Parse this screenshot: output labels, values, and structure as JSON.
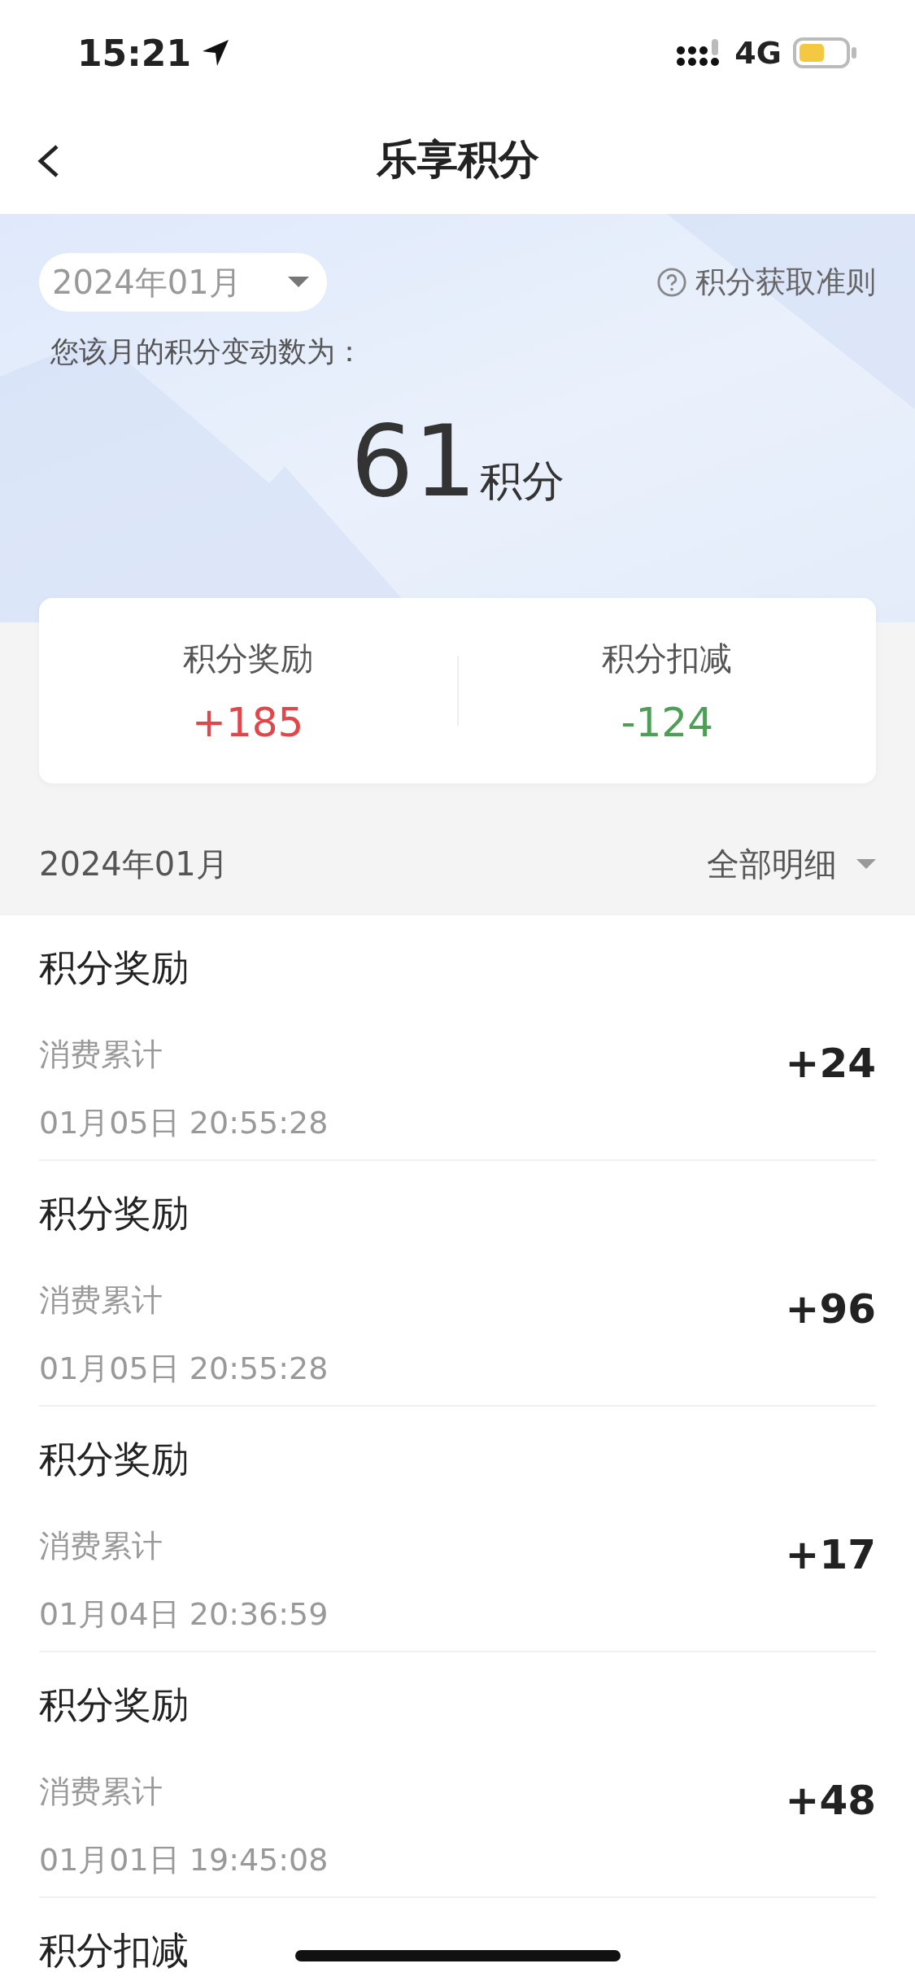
{
  "status_bar": {
    "time": "15:21",
    "network": "4G"
  },
  "nav": {
    "title": "乐享积分"
  },
  "header": {
    "month_selector": "2024年01月",
    "rules_link": "积分获取准则",
    "caption": "您该月的积分变动数为：",
    "total": "61",
    "unit": "积分"
  },
  "summary": [
    {
      "label": "积分奖励",
      "value": "+185",
      "kind": "reward"
    },
    {
      "label": "积分扣减",
      "value": "-124",
      "kind": "deduction"
    }
  ],
  "list_header": {
    "month": "2024年01月",
    "filter": "全部明细"
  },
  "records": [
    {
      "title": "积分奖励",
      "source": "消费累计",
      "time": "01月05日 20:55:28",
      "amount": "+24"
    },
    {
      "title": "积分奖励",
      "source": "消费累计",
      "time": "01月05日 20:55:28",
      "amount": "+96"
    },
    {
      "title": "积分奖励",
      "source": "消费累计",
      "time": "01月04日 20:36:59",
      "amount": "+17"
    },
    {
      "title": "积分奖励",
      "source": "消费累计",
      "time": "01月01日 19:45:08",
      "amount": "+48"
    },
    {
      "title": "积分扣减"
    }
  ]
}
